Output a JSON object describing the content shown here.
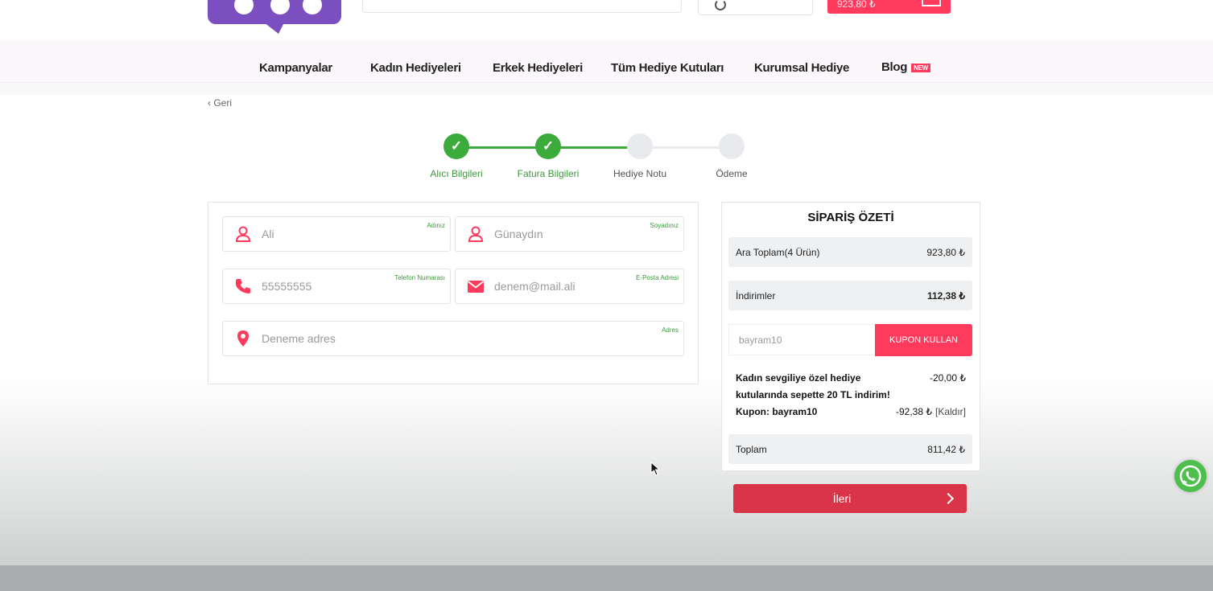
{
  "header": {
    "cart_amount": "923,80 ₺",
    "colors": {
      "brand_purple": "#7b4fbf",
      "accent_red": "#ff3a5c"
    }
  },
  "nav": {
    "items": [
      {
        "label": "Kampanyalar"
      },
      {
        "label": "Kadın Hediyeleri"
      },
      {
        "label": "Erkek Hediyeleri"
      },
      {
        "label": "Tüm Hediye Kutuları"
      },
      {
        "label": "Kurumsal Hediye"
      },
      {
        "label": "Blog",
        "badge": "NEW"
      }
    ]
  },
  "back_link": "‹ Geri",
  "steps": [
    {
      "label": "Alıcı Bilgileri",
      "done": true
    },
    {
      "label": "Fatura Bilgileri",
      "done": true
    },
    {
      "label": "Hediye Notu",
      "done": false
    },
    {
      "label": "Ödeme",
      "done": false
    }
  ],
  "form": {
    "first_name": {
      "value": "Ali",
      "label": "Adınız",
      "icon": "user-icon"
    },
    "last_name": {
      "value": "Günaydın",
      "label": "Soyadınız",
      "icon": "user-icon"
    },
    "phone": {
      "value": "55555555",
      "label": "Telefon Numarası",
      "icon": "phone-icon"
    },
    "email": {
      "value": "denem@mail.ali",
      "label": "E-Posta Adresi",
      "icon": "envelope-icon"
    },
    "address": {
      "value": "Deneme adres",
      "label": "Adres",
      "icon": "map-pin-icon"
    }
  },
  "summary": {
    "title": "SİPARİŞ ÖZETİ",
    "subtotal_label": "Ara Toplam(4 Ürün)",
    "subtotal_value": "923,80 ₺",
    "discounts_label": "İndirimler",
    "discounts_value": "112,38 ₺",
    "coupon_value": "bayram10",
    "coupon_button": "KUPON KULLAN",
    "promo_line1": "Kadın sevgiliye özel hediye",
    "promo_line2": "kutularında sepette 20 TL indirim!",
    "promo_amount": "-20,00 ₺",
    "coupon_line": "Kupon: bayram10",
    "coupon_amount": "-92,38 ₺",
    "coupon_remove": "[Kaldır]",
    "total_label": "Toplam",
    "total_value": "811,42 ₺"
  },
  "next_button": "İleri"
}
